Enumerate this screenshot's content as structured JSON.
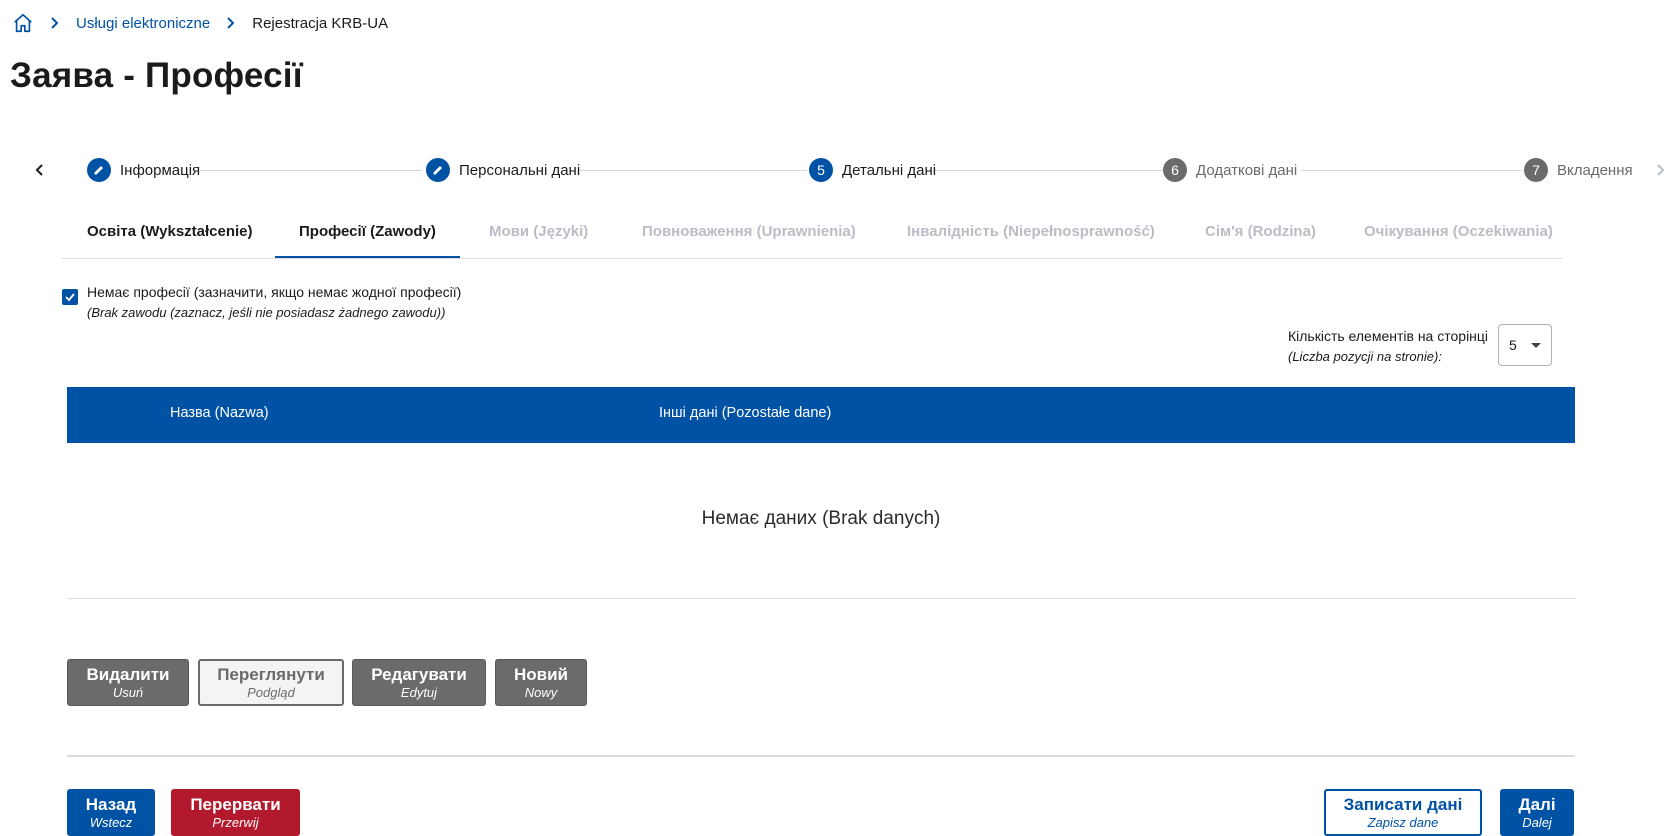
{
  "breadcrumb": {
    "home_icon": "home-icon",
    "items": [
      {
        "label": "Usługi elektroniczne"
      },
      {
        "label": "Rejestracja KRB-UA"
      }
    ]
  },
  "page_title": "Заява - Професії",
  "stepper": {
    "steps": [
      {
        "icon": "pencil-icon",
        "label": "Інформація"
      },
      {
        "icon": "pencil-icon",
        "label": "Персональні дані"
      },
      {
        "number": "5",
        "label": "Детальні дані"
      },
      {
        "number": "6",
        "label": "Додаткові дані"
      },
      {
        "number": "7",
        "label": "Вкладення"
      }
    ]
  },
  "tabs": [
    {
      "label": "Освіта (Wykształcenie)",
      "state": "enabled"
    },
    {
      "label": "Професії (Zawody)",
      "state": "active"
    },
    {
      "label": "Мови (Języki)",
      "state": "disabled"
    },
    {
      "label": "Повноваження (Uprawnienia)",
      "state": "disabled"
    },
    {
      "label": "Інвалідність (Niepełnosprawność)",
      "state": "disabled"
    },
    {
      "label": "Сім'я (Rodzina)",
      "state": "disabled"
    },
    {
      "label": "Очікування (Oczekiwania)",
      "state": "disabled"
    }
  ],
  "no_profession": {
    "checked": true,
    "label": "Немає професії (зазначити, якщо немає жодної професії)",
    "label_pl": "(Brak zawodu (zaznacz, jeśli nie posiadasz żadnego zawodu))"
  },
  "per_page": {
    "label": "Кількість елементів на сторінці",
    "label_pl": "(Liczba pozycji na stronie):",
    "value": "5"
  },
  "table": {
    "columns": [
      "Назва (Nazwa)",
      "Інші дані (Pozostałe dane)"
    ],
    "empty_text": "Немає даних (Brak danych)"
  },
  "row_actions": {
    "delete": {
      "label": "Видалити",
      "sub": "Usuń"
    },
    "preview": {
      "label": "Переглянути",
      "sub": "Podgląd"
    },
    "edit": {
      "label": "Редагувати",
      "sub": "Edytuj"
    },
    "new": {
      "label": "Новий",
      "sub": "Nowy"
    }
  },
  "footer": {
    "back": {
      "label": "Назад",
      "sub": "Wstecz"
    },
    "abort": {
      "label": "Перервати",
      "sub": "Przerwij"
    },
    "save": {
      "label": "Записати дані",
      "sub": "Zapisz dane"
    },
    "next": {
      "label": "Далі",
      "sub": "Dalej"
    }
  },
  "colors": {
    "primary": "#0052a5",
    "danger": "#b3192c",
    "neutral": "#6b6b6b"
  }
}
